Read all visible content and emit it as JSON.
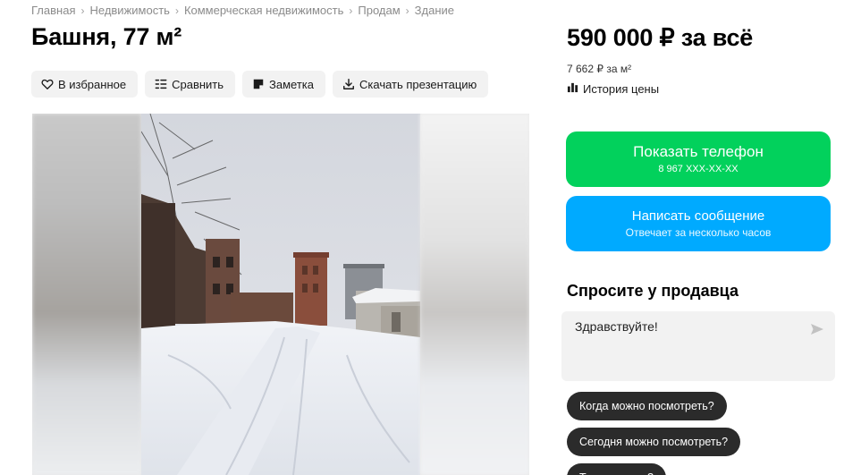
{
  "breadcrumb": [
    "Главная",
    "Недвижимость",
    "Коммерческая недвижимость",
    "Продам",
    "Здание"
  ],
  "title": "Башня, 77 м²",
  "actions": {
    "favorite": "В избранное",
    "compare": "Сравнить",
    "note": "Заметка",
    "download": "Скачать презентацию"
  },
  "price": {
    "total": "590 000 ₽ за всё",
    "per_meter": "7 662 ₽ за м²",
    "history": "История цены"
  },
  "contact": {
    "phone_label": "Показать телефон",
    "phone_number": "8 967 XXX-XX-XX",
    "message_label": "Написать сообщение",
    "message_sub": "Отвечает за несколько часов"
  },
  "ask": {
    "title": "Спросите у продавца",
    "input_value": "Здравствуйте!",
    "chips": [
      "Когда можно посмотреть?",
      "Сегодня можно посмотреть?",
      "Торг уместен?"
    ]
  },
  "colors": {
    "phone_button": "#02d15c",
    "message_button": "#00aaff",
    "chip": "#2b2b2b"
  },
  "icons": {
    "favorite": "heart-icon",
    "compare": "compare-icon",
    "note": "note-icon",
    "download": "download-icon",
    "history": "chart-icon",
    "send": "send-icon"
  }
}
